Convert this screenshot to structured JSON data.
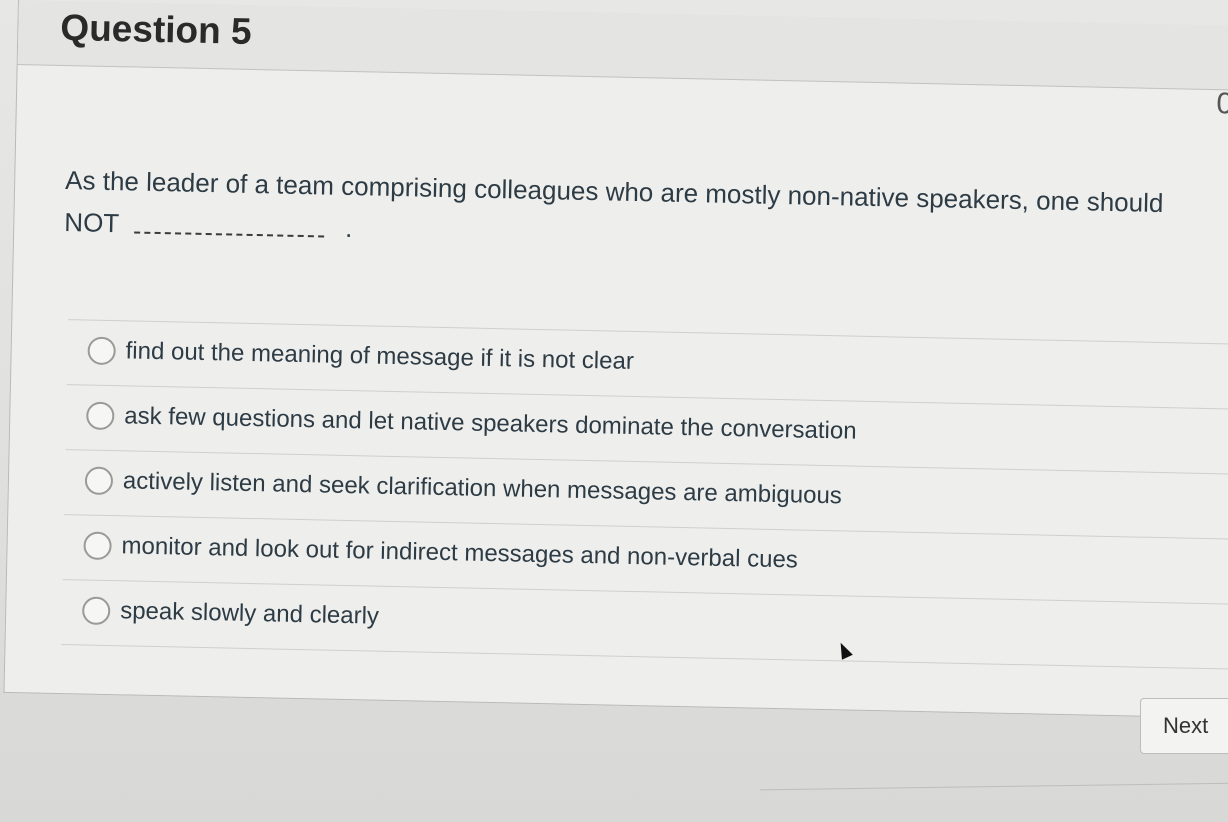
{
  "question": {
    "title": "Question 5",
    "points_fragment": "0",
    "text": "As the leader of a team comprising colleagues who are mostly non-native speakers, one should",
    "text_line2": "NOT",
    "blank_suffix": "."
  },
  "answers": [
    {
      "label": "find out the meaning of message if it is not clear"
    },
    {
      "label": "ask few questions and let native speakers dominate the conversation"
    },
    {
      "label": "actively listen and seek clarification when messages are ambiguous"
    },
    {
      "label": "monitor and look out for indirect messages and non-verbal cues"
    },
    {
      "label": "speak slowly and clearly"
    }
  ],
  "navigation": {
    "next_label": "Next"
  }
}
